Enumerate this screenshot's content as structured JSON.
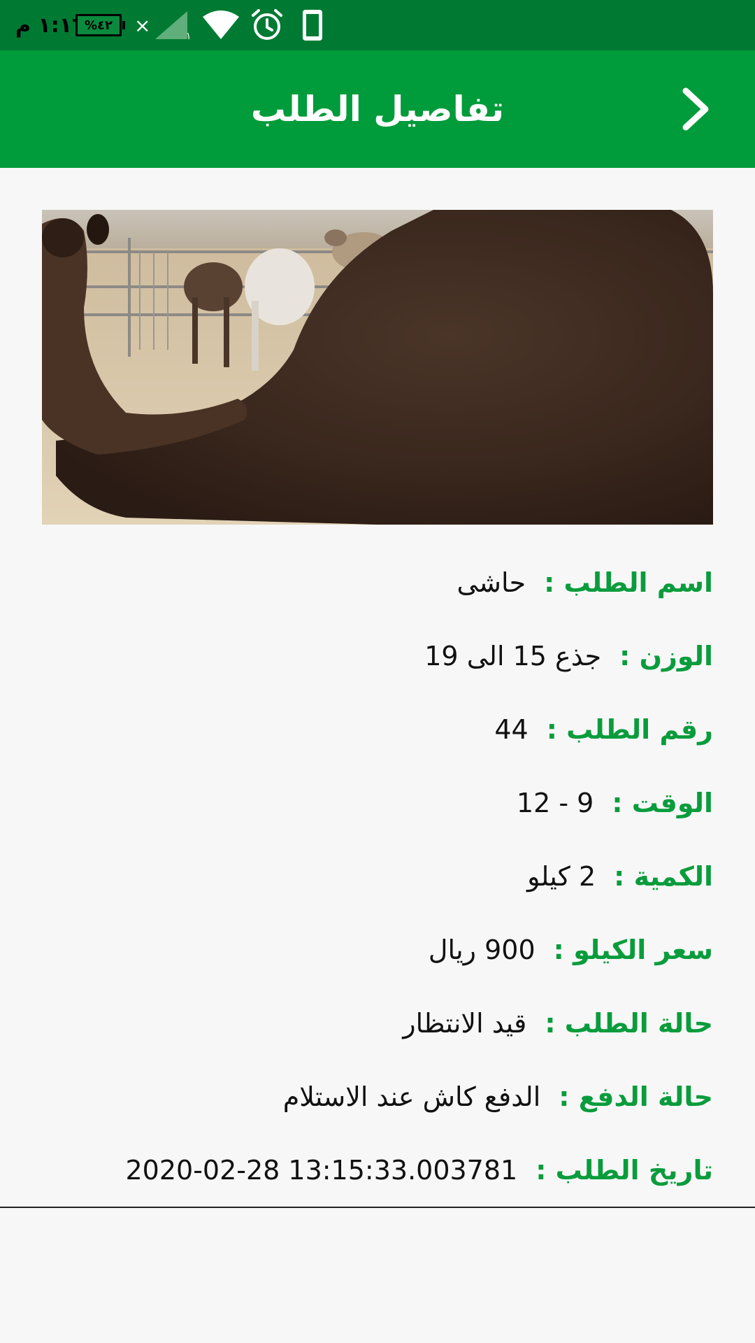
{
  "status_bar": {
    "time": "١:١٦ م",
    "battery": "%٤٢",
    "signal_extra": "×",
    "sim": "١"
  },
  "header": {
    "title": "تفاصيل الطلب",
    "back_icon": "chevron-right-icon"
  },
  "photo": {
    "subject": "camel"
  },
  "details": [
    {
      "label": "اسم الطلب :",
      "value": "حاشى"
    },
    {
      "label": "الوزن :",
      "value": "جذع 15 الى 19"
    },
    {
      "label": "رقم الطلب :",
      "value": "44"
    },
    {
      "label": "الوقت :",
      "value": "9 - 12"
    },
    {
      "label": "الكمية :",
      "value": "2 كيلو"
    },
    {
      "label": "سعر الكيلو :",
      "value": "900 ريال"
    },
    {
      "label": "حالة الطلب :",
      "value": "قيد الانتظار"
    },
    {
      "label": "حالة الدفع :",
      "value": "الدفع كاش عند الاستلام"
    },
    {
      "label": "تاريخ الطلب :",
      "value": "2020-02-28 13:15:33.003781"
    }
  ],
  "colors": {
    "status_bar": "#007a33",
    "app_bar": "#009b3a",
    "label": "#0a9c3c",
    "background": "#f7f7f7"
  }
}
